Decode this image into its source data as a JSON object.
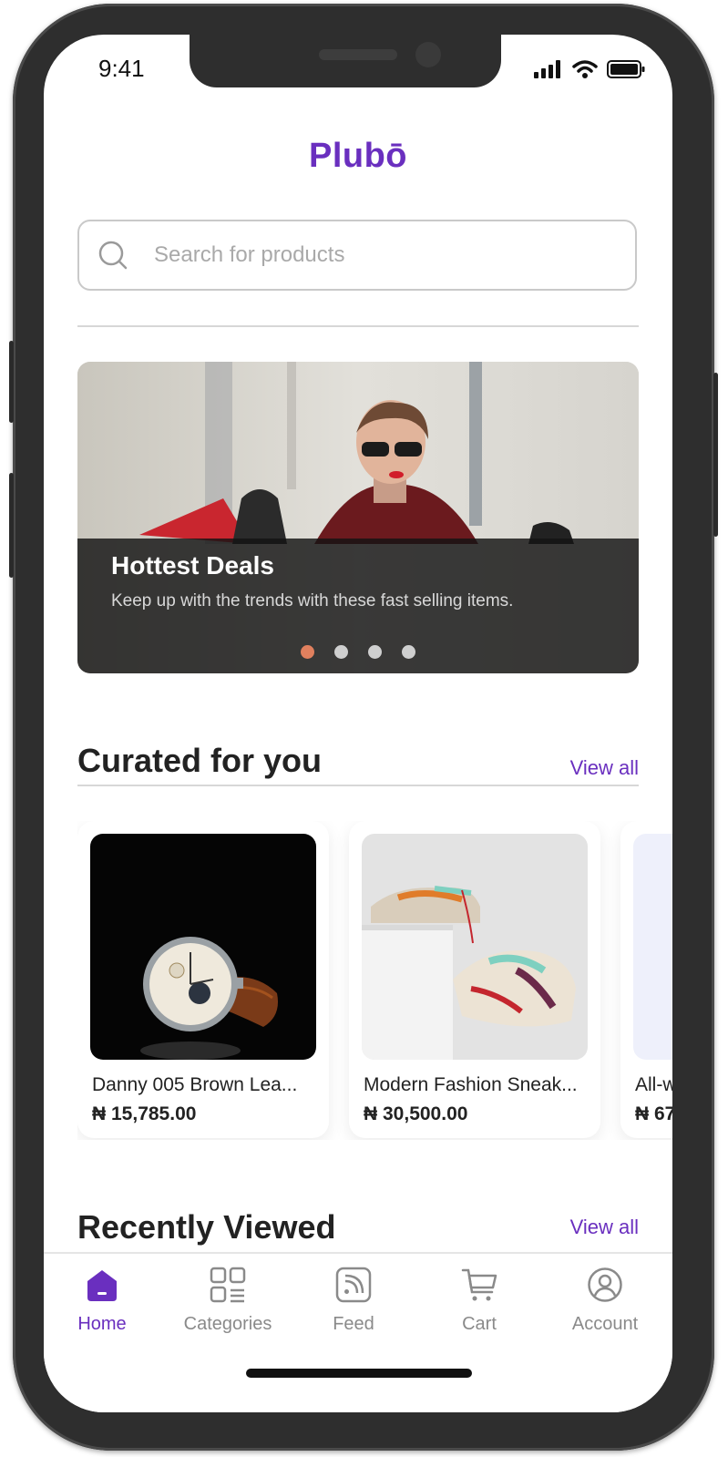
{
  "status_bar": {
    "time": "9:41"
  },
  "app": {
    "logo_text": "Plubō",
    "brand_color": "#6a2fbf"
  },
  "search": {
    "placeholder": "Search for products",
    "value": ""
  },
  "banner": {
    "title": "Hottest Deals",
    "subtitle": "Keep up with the trends with these fast selling items.",
    "slide_count": 4,
    "active_slide": 1,
    "active_dot_color": "#e0805e"
  },
  "curated": {
    "title": "Curated for you",
    "view_all": "View all",
    "products": [
      {
        "name": "Danny 005 Brown Lea...",
        "price": "₦ 15,785.00",
        "image": "watch"
      },
      {
        "name": "Modern Fashion Sneak...",
        "price": "₦ 30,500.00",
        "image": "sneakers"
      },
      {
        "name": "All-w",
        "price": "₦ 67",
        "image": "partial"
      }
    ]
  },
  "recent": {
    "title": "Recently Viewed",
    "view_all": "View all"
  },
  "nav": {
    "items": [
      {
        "label": "Home",
        "icon": "home-icon",
        "active": true
      },
      {
        "label": "Categories",
        "icon": "categories-icon",
        "active": false
      },
      {
        "label": "Feed",
        "icon": "feed-icon",
        "active": false
      },
      {
        "label": "Cart",
        "icon": "cart-icon",
        "active": false
      },
      {
        "label": "Account",
        "icon": "account-icon",
        "active": false
      }
    ]
  }
}
